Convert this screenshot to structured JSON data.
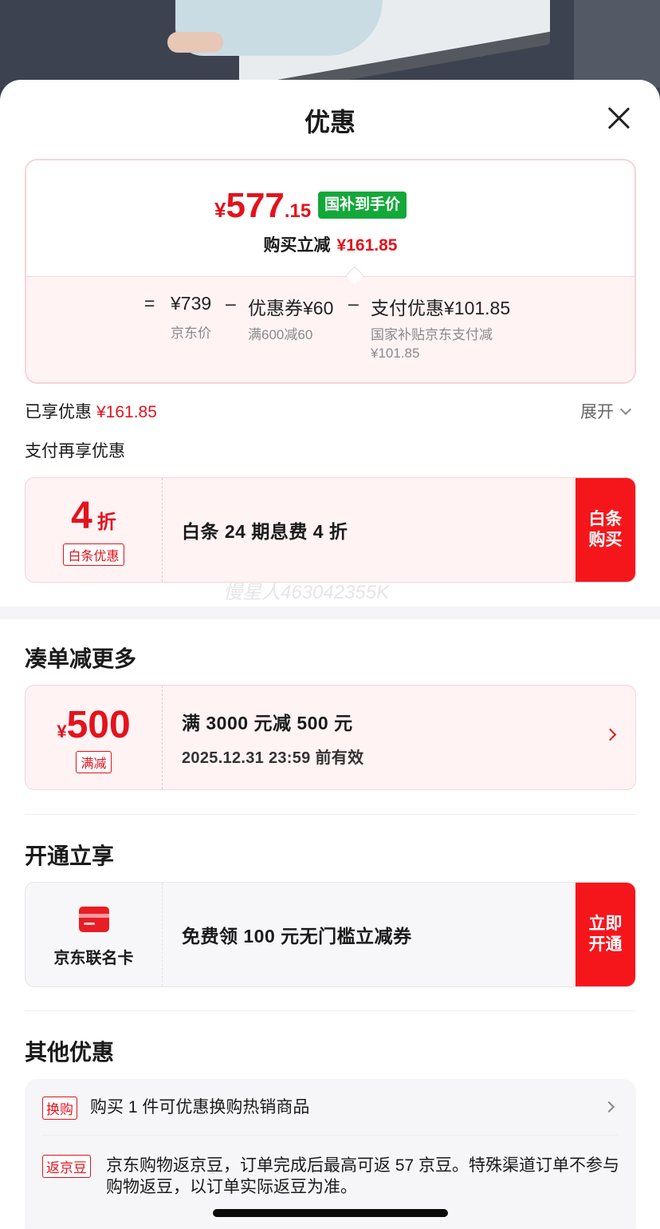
{
  "sheet": {
    "title": "优惠"
  },
  "price_card": {
    "yen": "¥",
    "price_int": "577",
    "price_dec": ".15",
    "subsidy_tag": "国补到手价",
    "reduce_label": "购买立减",
    "reduce_value": "¥161.85",
    "eq": "=",
    "jd_price": "¥739",
    "jd_price_label": "京东价",
    "minus1": "–",
    "coupon_label": "优惠券¥60",
    "coupon_desc": "满600减60",
    "minus2": "–",
    "pay_label": "支付优惠¥101.85",
    "pay_desc_line1": "国家补贴京东支付减",
    "pay_desc_line2": "¥101.85"
  },
  "enjoyed": {
    "label": "已享优惠",
    "value": "¥161.85",
    "expand": "展开"
  },
  "pay_more_title": "支付再享优惠",
  "baitiao": {
    "num": "4",
    "unit": "折",
    "tag": "白条优惠",
    "text": "白条 24 期息费 4 折",
    "action": "白条购买"
  },
  "watermark": "慢星人463042355K",
  "combine": {
    "title": "凑单减更多",
    "yen": "¥",
    "amount": "500",
    "tag": "满减",
    "text": "满 3000 元减 500 元",
    "valid": "2025.12.31 23:59 前有效"
  },
  "open": {
    "title": "开通立享",
    "card_name": "京东联名卡",
    "text": "免费领 100 元无门槛立减券",
    "action": "立即开通"
  },
  "others": {
    "title": "其他优惠",
    "rows": [
      {
        "tag": "换购",
        "text": "购买 1 件可优惠换购热销商品"
      },
      {
        "tag": "返京豆",
        "text": "京东购物返京豆，订单完成后最高可返 57 京豆。特殊渠道订单不参与购物返豆，以订单实际返豆为准。"
      }
    ]
  },
  "colors": {
    "accent_red": "#e4121c",
    "button_red": "#f5161c",
    "subsidy_green": "#14a83a"
  }
}
